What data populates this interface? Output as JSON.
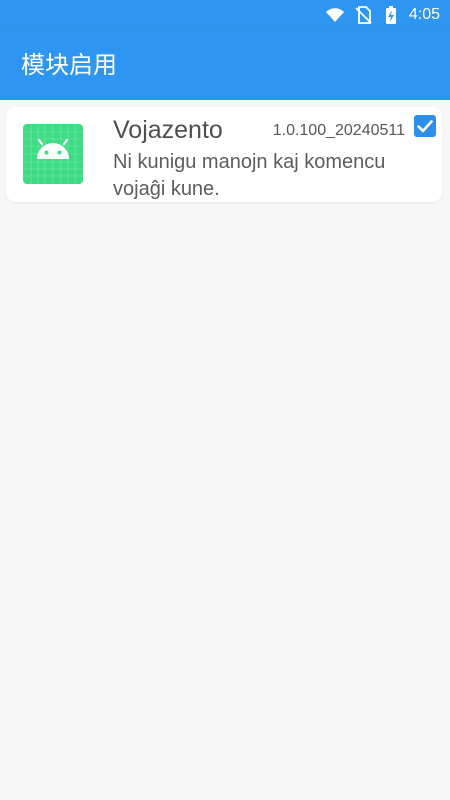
{
  "status_bar": {
    "time": "4:05",
    "icons": [
      "wifi-icon",
      "no-sim-icon",
      "battery-charging-icon"
    ]
  },
  "app_bar": {
    "title": "模块启用"
  },
  "modules": [
    {
      "icon": "android-app-icon",
      "name": "Vojazento",
      "version": "1.0.100_20240511",
      "description": "Ni kunigu manojn kaj komencu vojaĝi kune.",
      "enabled": true
    }
  ],
  "colors": {
    "primary": "#2e96f0",
    "checkbox": "#2e8fe9",
    "background": "#f7f7f7",
    "card": "#ffffff",
    "icon_bg": "#3ddc84"
  }
}
